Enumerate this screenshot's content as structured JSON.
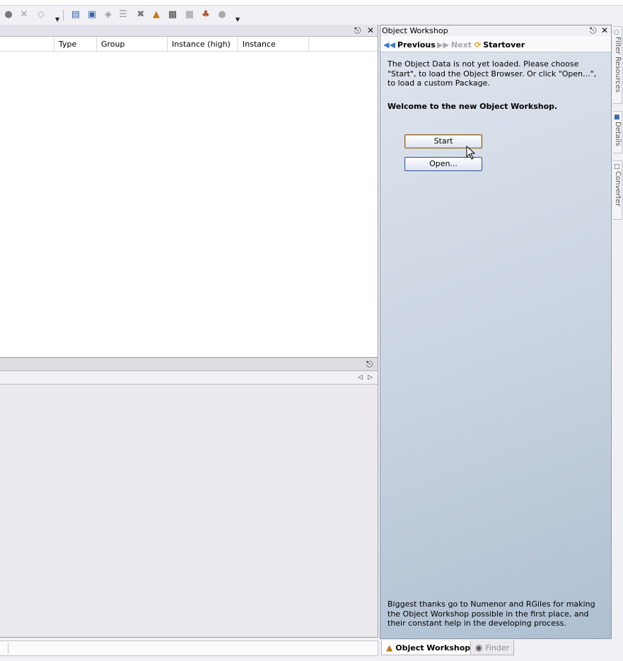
{
  "columns": [
    "Type",
    "Group",
    "Instance (high)",
    "Instance"
  ],
  "object_workshop": {
    "title": "Object Workshop",
    "nav": {
      "previous": "Previous",
      "next": "Next",
      "startover": "Startover"
    },
    "intro": "The Object Data is not yet loaded. Please choose \"Start\", to load the Object Browser. Or click \"Open...\", to load a custom Package.",
    "welcome": "Welcome to the new Object Workshop.",
    "start_label": "Start",
    "open_label": "Open...",
    "thanks": "Biggest thanks go to Numenor and RGiles for making the Object Workshop possible in the first place, and their constant help in the developing process."
  },
  "bottom_tabs": {
    "object_workshop": "Object Workshop",
    "finder": "Finder"
  },
  "side_tabs": {
    "filter": "Filter Resources",
    "details": "Details",
    "converter": "Converter"
  },
  "colors": {
    "accent_border": "#2b4d8f",
    "start_border": "#8c6021",
    "pane_gradient_end": "#aebfd2"
  }
}
